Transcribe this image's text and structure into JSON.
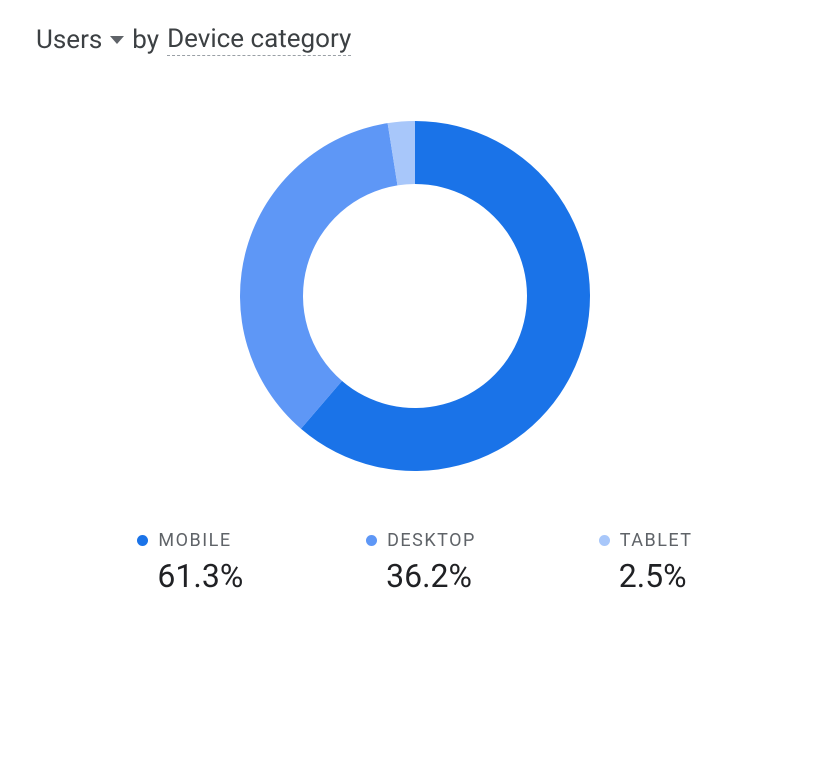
{
  "header": {
    "metric": "Users",
    "by_text": "by",
    "dimension": "Device category"
  },
  "chart_data": {
    "type": "pie",
    "title": "Users by Device category",
    "donut": true,
    "series": [
      {
        "name": "MOBILE",
        "value": 61.3,
        "color": "#1a73e8"
      },
      {
        "name": "DESKTOP",
        "value": 36.2,
        "color": "#5e97f6"
      },
      {
        "name": "TABLET",
        "value": 2.5,
        "color": "#a8c7fa"
      }
    ]
  },
  "legend": {
    "items": [
      {
        "label": "MOBILE",
        "value": "61.3%",
        "color": "#1a73e8"
      },
      {
        "label": "DESKTOP",
        "value": "36.2%",
        "color": "#5e97f6"
      },
      {
        "label": "TABLET",
        "value": "2.5%",
        "color": "#a8c7fa"
      }
    ]
  }
}
